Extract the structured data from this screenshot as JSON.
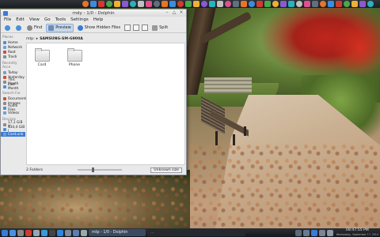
{
  "window": {
    "title": "rndy - 1/0 - Dolphin",
    "menu": [
      "File",
      "Edit",
      "View",
      "Go",
      "Tools",
      "Settings",
      "Help"
    ],
    "toolbar": {
      "find_label": "Find",
      "preview_label": "Preview",
      "hidden_files_label": "Show Hidden Files",
      "split_label": "Split"
    },
    "sidebar": {
      "sections": [
        {
          "heading": "Places",
          "items": [
            "Home",
            "Network",
            "Root",
            "Trash"
          ]
        },
        {
          "heading": "Recently Acce",
          "items": [
            "Today",
            "Yesterday",
            "This Month",
            "Last Month"
          ]
        },
        {
          "heading": "Search For",
          "items": [
            "Documents",
            "Images",
            "Audio Files",
            "Videos"
          ]
        },
        {
          "heading": "Devices",
          "items": [
            "17,1 GiB H",
            "134,4 GiB I",
            "Card.unk"
          ]
        }
      ],
      "selected": "Card.unk"
    },
    "breadcrumb": {
      "root": "mtp:",
      "device": "SAMSUNG-SM-G900A"
    },
    "files": [
      {
        "name": "Card"
      },
      {
        "name": "Phone"
      }
    ],
    "status": {
      "count": "2 Folders",
      "free": "Unknown size"
    }
  },
  "colors": {
    "accent": "#3b7bd5",
    "titlebar": "#dadada",
    "panel": "#1b1e22"
  },
  "taskbar": {
    "active_task": "mtp - 1/0 - Dolphin",
    "other_task": "…",
    "clock_time": "08:47:55 PM",
    "clock_date": "Wednesday, September 17, 2014"
  },
  "icons": {
    "top_panel": [
      "firefox-icon",
      "chrome-icon",
      "opera-icon",
      "app-icon",
      "app-icon",
      "app-icon",
      "app-icon",
      "app-icon",
      "app-icon",
      "app-icon",
      "app-icon",
      "app-icon",
      "app-icon",
      "app-icon",
      "app-icon",
      "app-icon",
      "app-icon",
      "app-icon",
      "app-icon",
      "app-icon",
      "app-icon",
      "app-icon",
      "app-icon",
      "app-icon",
      "app-icon",
      "app-icon",
      "app-icon",
      "app-icon",
      "app-icon",
      "app-icon",
      "app-icon",
      "app-icon",
      "app-icon",
      "app-icon",
      "app-icon",
      "app-icon",
      "app-icon"
    ],
    "taskbar_launchers": [
      "menu-icon",
      "folder-icon",
      "tools-icon",
      "close-icon",
      "wrench-icon",
      "download-icon",
      "terminal-icon",
      "browser-icon",
      "monitor-icon",
      "files-icon",
      "settings-icon"
    ]
  }
}
